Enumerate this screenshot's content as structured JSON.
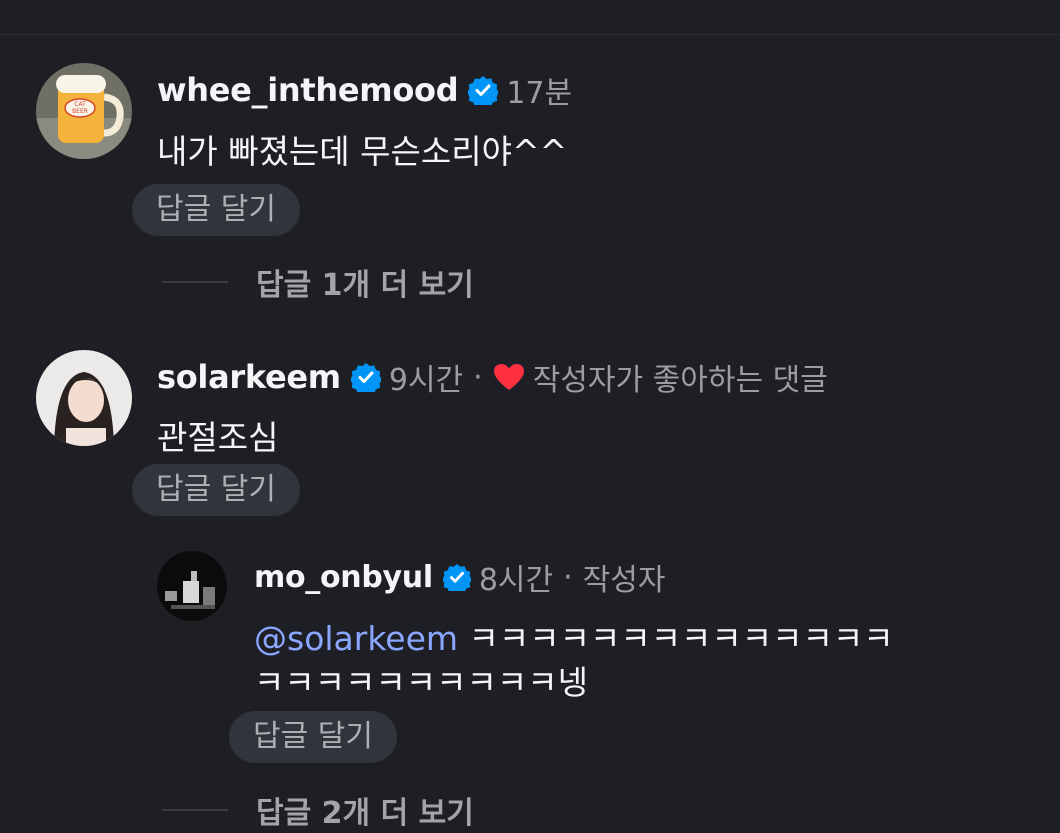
{
  "comments": [
    {
      "username": "whee_inthemood",
      "time": "17분",
      "text": "내가 빠졌는데 무슨소리야^^",
      "reply_label": "답글 달기",
      "view_more": "답글 1개 더 보기"
    },
    {
      "username": "solarkeem",
      "time": "9시간",
      "liked_label": "작성자가 좋아하는 댓글",
      "text": "관절조심",
      "reply_label": "답글 달기"
    }
  ],
  "reply": {
    "username": "mo_onbyul",
    "time": "8시간",
    "author_label": "작성자",
    "mention": "@solarkeem",
    "text_line1": "ㅋㅋㅋㅋㅋㅋㅋㅋㅋㅋㅋㅋㅋㅋ",
    "text_line2": "ㅋㅋㅋㅋㅋㅋㅋㅋㅋㅋ넹",
    "reply_label": "답글 달기"
  },
  "footer": {
    "view_more": "답글 2개 더 보기"
  },
  "colors": {
    "background": "#1e1f25",
    "verified": "#0095f6",
    "heart": "#ff3040",
    "mention": "#8aa6ff"
  },
  "icons": {
    "verified": "verified-badge-icon",
    "heart": "heart-icon"
  }
}
